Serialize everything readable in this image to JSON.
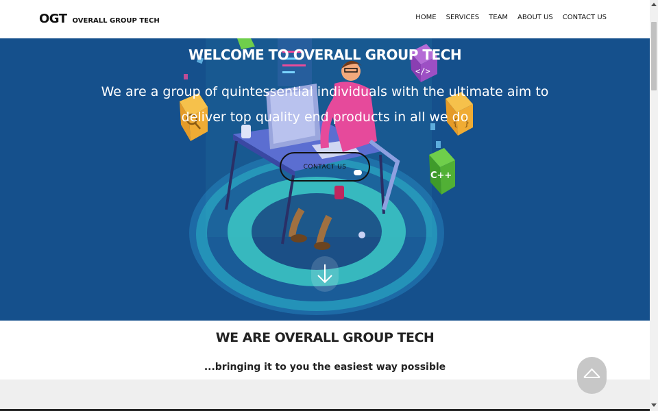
{
  "header": {
    "logo_mark": "OGT",
    "logo_text": "OVERALL GROUP TECH",
    "nav": [
      "HOME",
      "SERVICES",
      "TEAM",
      "ABOUT US",
      "CONTACT US"
    ]
  },
  "hero": {
    "title": "WELCOME TO OVERALL GROUP TECH",
    "subtitle": "We are a group of quintessential individuals with the ultimate aim to deliver top quality end products in all we do",
    "button_label": "CONTACT US",
    "scroll_down_icon": "arrow-down-icon"
  },
  "about": {
    "title": "WE ARE OVERALL GROUP TECH",
    "subtitle": "...bringing it to you the easiest way possible"
  },
  "back_to_top_icon": "chevron-up-icon",
  "colors": {
    "hero_bg": "#15508c",
    "header_bg": "#ffffff",
    "accent_teal": "#3fd0c8"
  }
}
